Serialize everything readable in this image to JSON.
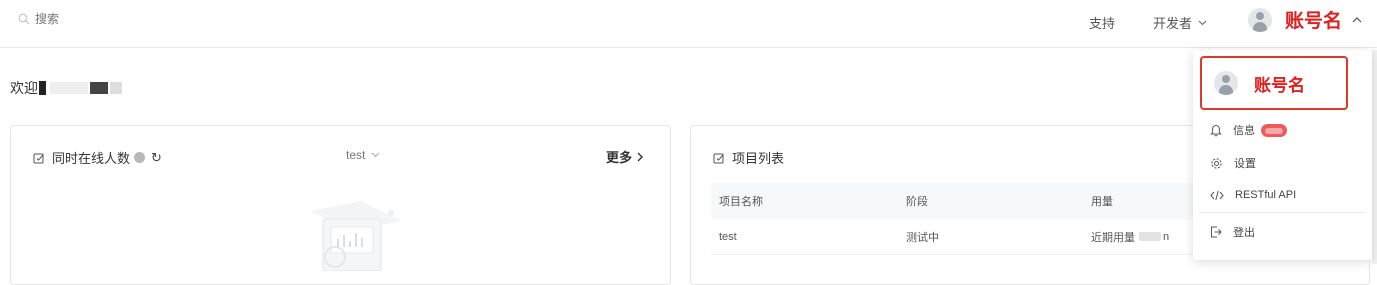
{
  "header": {
    "search_placeholder": "搜索",
    "support_label": "支持",
    "developer_label": "开发者",
    "account_name": "账号名"
  },
  "welcome": {
    "text": "欢迎"
  },
  "online_card": {
    "title": "同时在线人数",
    "refresh_icon": "refresh-icon",
    "select_value": "test",
    "more_label": "更多"
  },
  "projects_card": {
    "title": "项目列表",
    "columns": [
      "项目名称",
      "阶段",
      "用量"
    ],
    "rows": [
      {
        "name": "test",
        "stage": "测试中",
        "usage_prefix": "近期用量",
        "usage_suffix": "n"
      }
    ]
  },
  "account_menu": {
    "account_name": "账号名",
    "items": [
      {
        "label": "信息",
        "icon": "bell-icon"
      },
      {
        "label": "设置",
        "icon": "gear-icon"
      },
      {
        "label": "RESTful API",
        "icon": "code-icon"
      },
      {
        "label": "登出",
        "icon": "logout-icon"
      }
    ]
  },
  "colors": {
    "accent_red": "#e02020",
    "highlight_border": "#e0382a",
    "badge": "#ee5a5a"
  }
}
